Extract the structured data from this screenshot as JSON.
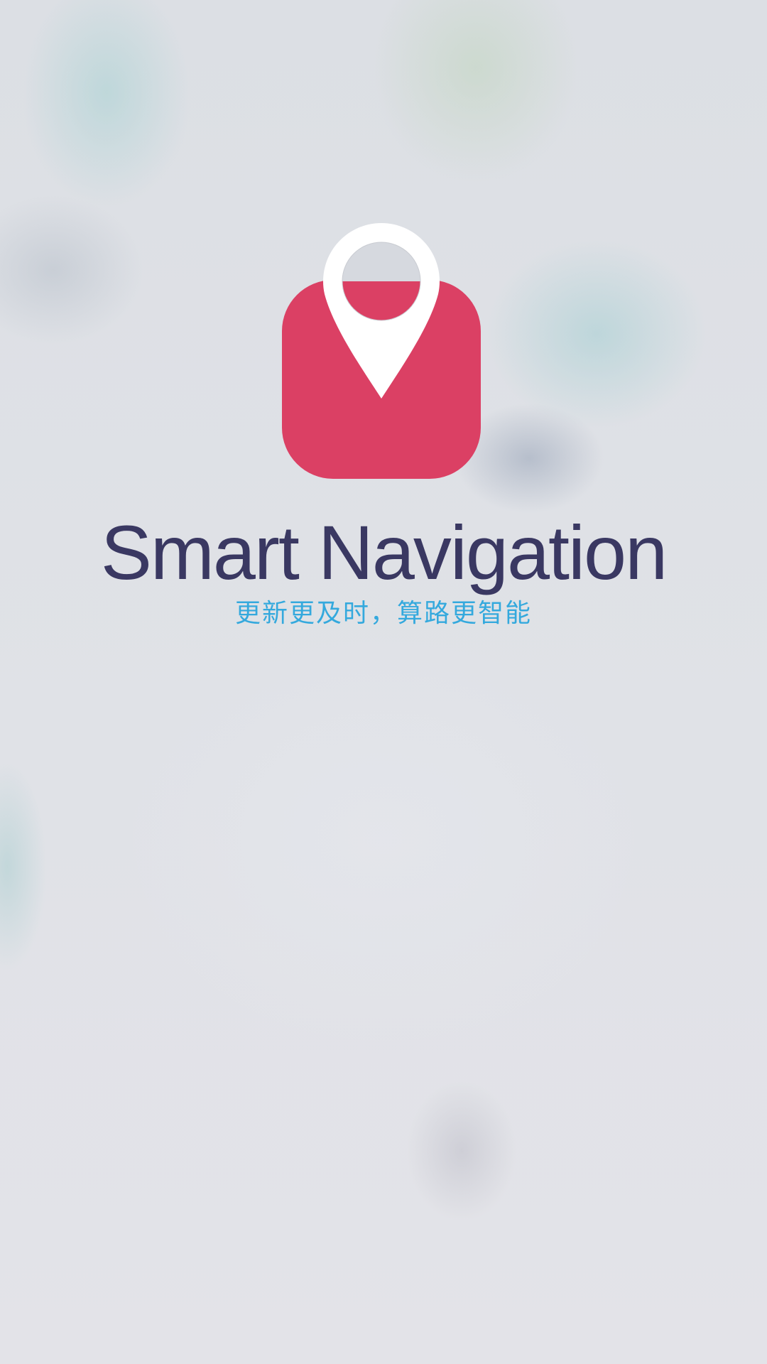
{
  "splash": {
    "logo_icon": "map-pin-bag-icon",
    "title": "Smart Navigation",
    "slogan": "更新更及时，算路更智能"
  },
  "colors": {
    "logo_red": "#db4064",
    "pin_white": "#ffffff",
    "title_navy": "#3a3862",
    "slogan_blue": "#34a9dd"
  }
}
